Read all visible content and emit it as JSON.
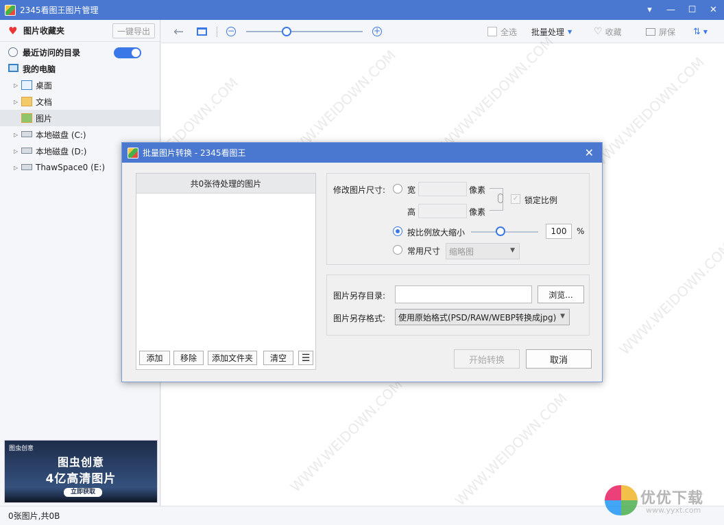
{
  "window": {
    "title": "2345看图王图片管理"
  },
  "sidebar": {
    "favorites_title": "图片收藏夹",
    "export_label": "一键导出",
    "recent_label": "最近访问的目录",
    "recent_toggle_on": true,
    "my_computer_label": "我的电脑",
    "items": [
      {
        "label": "桌面",
        "icon": "desktop-icon"
      },
      {
        "label": "文档",
        "icon": "documents-folder-icon"
      },
      {
        "label": "图片",
        "icon": "pictures-folder-icon",
        "selected": true
      },
      {
        "label": "本地磁盘 (C:)",
        "icon": "drive-icon"
      },
      {
        "label": "本地磁盘 (D:)",
        "icon": "drive-icon"
      },
      {
        "label": "ThawSpace0 (E:)",
        "icon": "drive-icon"
      }
    ],
    "ad": {
      "brand": "图虫创意",
      "line1": "图虫创意",
      "line2": "4亿高清图片",
      "cta": "立即获取"
    }
  },
  "toolbar": {
    "zoom_level": 0.31,
    "select_all": "全选",
    "batch": "批量处理",
    "favorite": "收藏",
    "screen": "屏保"
  },
  "statusbar": {
    "text": "0张图片,共0B"
  },
  "dialog": {
    "title": "批量图片转换 - 2345看图王",
    "pending_header": "共0张待处理的图片",
    "list_buttons": {
      "add": "添加",
      "remove": "移除",
      "add_folder": "添加文件夹",
      "clear": "清空"
    },
    "resize": {
      "label": "修改图片尺寸:",
      "width_label": "宽",
      "height_label": "高",
      "unit": "像素",
      "lock_ratio": "锁定比例",
      "scale_label": "按比例放大缩小",
      "scale_value": "100",
      "scale_unit": "%",
      "common_label": "常用尺寸",
      "common_value": "缩略图"
    },
    "save": {
      "dir_label": "图片另存目录:",
      "dir_value": "",
      "browse": "浏览...",
      "format_label": "图片另存格式:",
      "format_value": "使用原始格式(PSD/RAW/WEBP转换成jpg)"
    },
    "start": "开始转换",
    "cancel": "取消"
  },
  "watermark": {
    "text": "WWW.WEIDOWN.COM"
  },
  "site_logo": {
    "name": "优优下载",
    "url": "www.yyxt.com"
  },
  "colors": {
    "titlebar": "#4a78d0",
    "accent": "#3b78e7"
  }
}
